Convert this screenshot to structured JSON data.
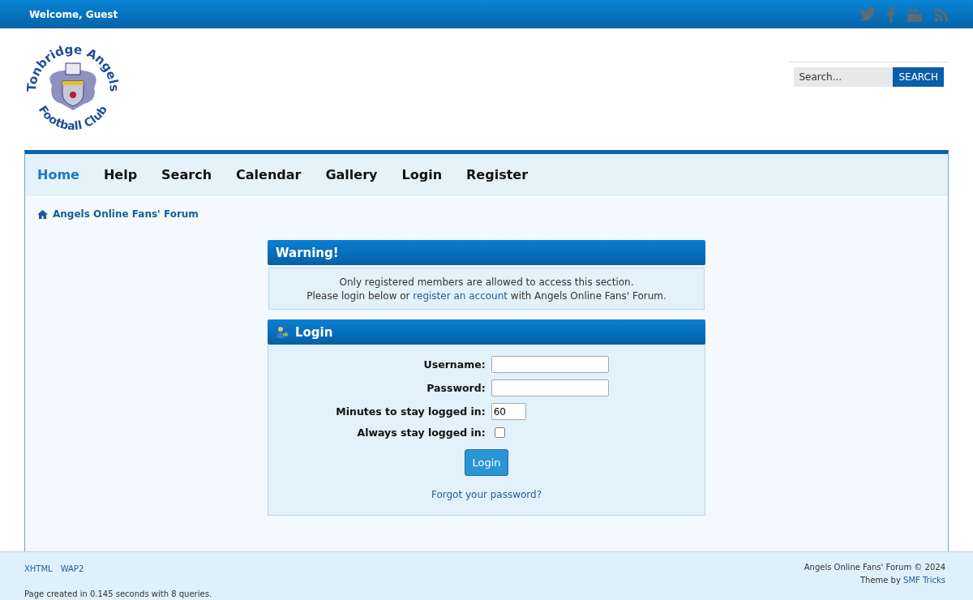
{
  "top_bar": {
    "welcome": "Welcome, Guest"
  },
  "logo_text": [
    "Tonbridge Angels",
    "Football Club"
  ],
  "search": {
    "placeholder": "Search...",
    "button": "SEARCH"
  },
  "nav": [
    {
      "label": "Home",
      "selected": true
    },
    {
      "label": "Help",
      "selected": false
    },
    {
      "label": "Search",
      "selected": false
    },
    {
      "label": "Calendar",
      "selected": false
    },
    {
      "label": "Gallery",
      "selected": false
    },
    {
      "label": "Login",
      "selected": false
    },
    {
      "label": "Register",
      "selected": false
    }
  ],
  "breadcrumb": "Angels Online Fans' Forum",
  "warning": {
    "title": "Warning!",
    "line1": "Only registered members are allowed to access this section.",
    "line2_before": "Please login below or ",
    "line2_link": "register an account",
    "line2_after": " with Angels Online Fans' Forum."
  },
  "login": {
    "title": "Login",
    "username_label": "Username:",
    "password_label": "Password:",
    "minutes_label": "Minutes to stay logged in:",
    "minutes_value": "60",
    "always_label": "Always stay logged in:",
    "always_checked": false,
    "button": "Login",
    "forgot": "Forgot your password?"
  },
  "footer": {
    "links": [
      "XHTML",
      "WAP2"
    ],
    "stats": "Page created in 0.145 seconds with 8 queries.",
    "copyright": "Angels Online Fans' Forum © 2024",
    "theme_before": "Theme by ",
    "theme_link": "SMF Tricks"
  }
}
